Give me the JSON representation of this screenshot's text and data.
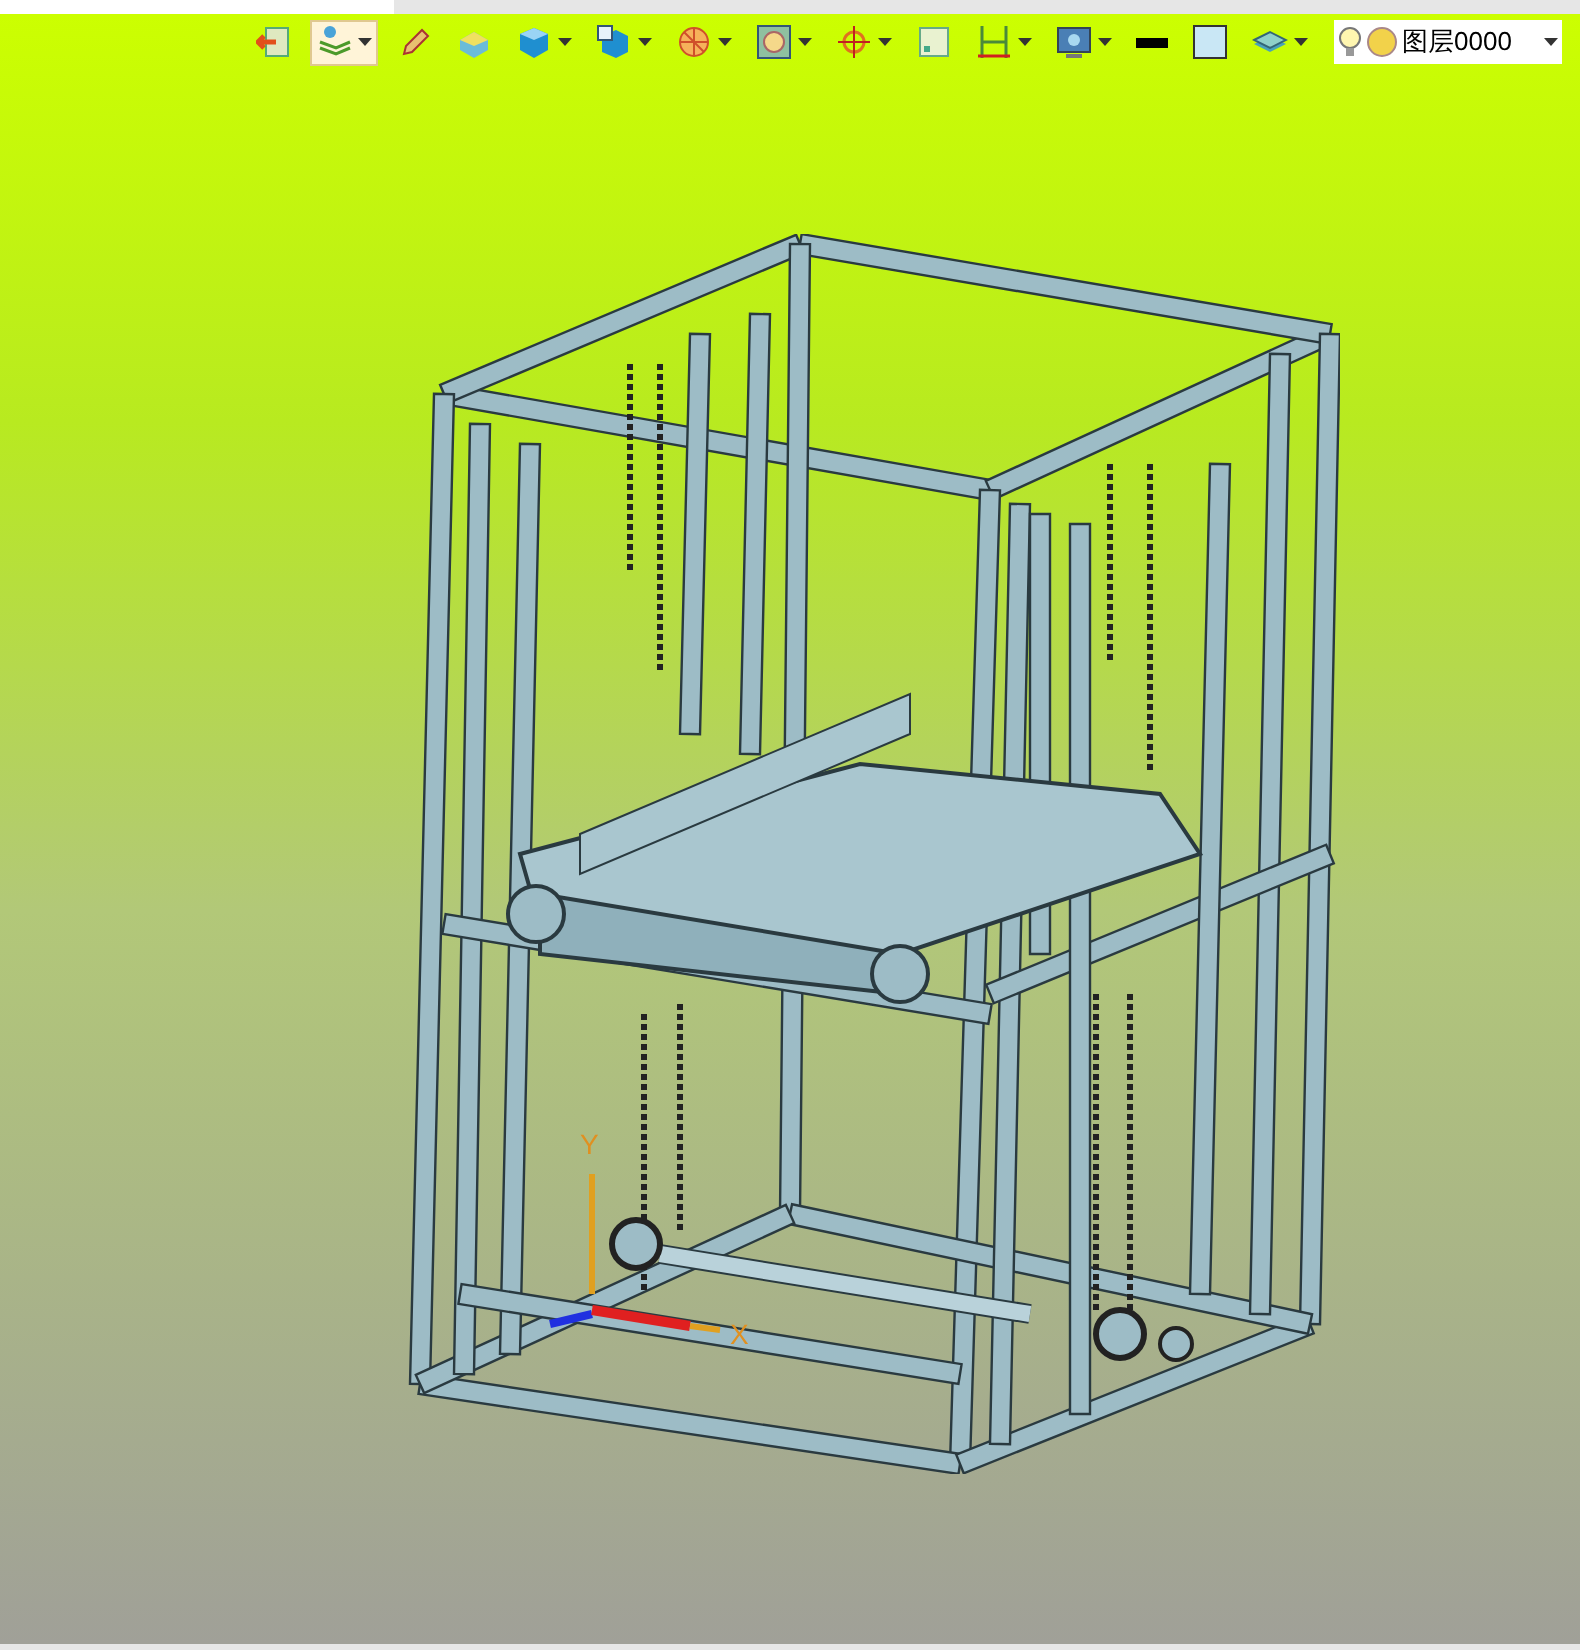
{
  "toolbar": {
    "tools": [
      {
        "kind": "exit",
        "selected": false,
        "dropdown": false
      },
      {
        "kind": "layers",
        "selected": true,
        "dropdown": true
      },
      {
        "kind": "pencil",
        "selected": false,
        "dropdown": false
      },
      {
        "kind": "box",
        "selected": false,
        "dropdown": false
      },
      {
        "kind": "cube",
        "selected": false,
        "dropdown": true
      },
      {
        "kind": "view",
        "selected": false,
        "dropdown": true
      },
      {
        "kind": "sphere",
        "selected": false,
        "dropdown": true
      },
      {
        "kind": "frame",
        "selected": false,
        "dropdown": true
      },
      {
        "kind": "target",
        "selected": false,
        "dropdown": true
      },
      {
        "kind": "square",
        "selected": false,
        "dropdown": false
      },
      {
        "kind": "measure",
        "selected": false,
        "dropdown": true
      },
      {
        "kind": "monitor",
        "selected": false,
        "dropdown": true
      },
      {
        "kind": "line",
        "selected": false,
        "dropdown": false
      },
      {
        "kind": "fill",
        "selected": false,
        "dropdown": false
      },
      {
        "kind": "stack",
        "selected": false,
        "dropdown": true
      }
    ],
    "layer": {
      "value": "图层0000",
      "visible": true
    }
  },
  "viewport": {
    "axes": {
      "x_label": "X",
      "y_label": "Y"
    }
  }
}
